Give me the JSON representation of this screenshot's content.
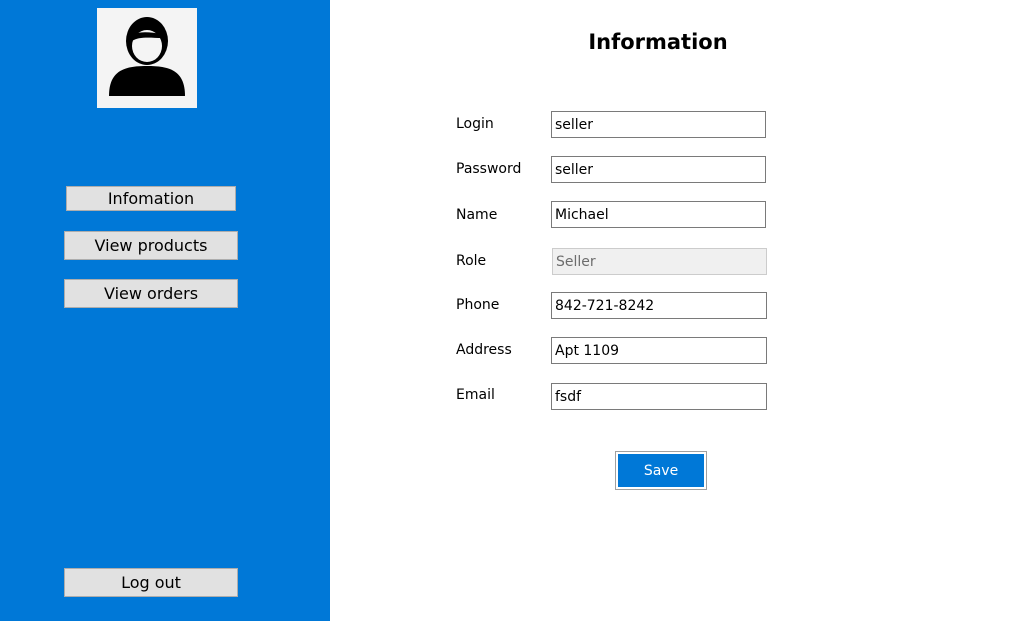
{
  "colors": {
    "sidebar_bg": "#0078d7",
    "save_button_bg": "#0078d7"
  },
  "sidebar": {
    "avatar_icon": "user-avatar-icon",
    "nav": [
      {
        "label": "Infomation"
      },
      {
        "label": "View products"
      },
      {
        "label": "View orders"
      }
    ],
    "logout_label": "Log out"
  },
  "form": {
    "title": "Information",
    "fields": [
      {
        "label": "Login",
        "value": "seller",
        "disabled": false
      },
      {
        "label": "Password",
        "value": "seller",
        "disabled": false
      },
      {
        "label": "Name",
        "value": "Michael",
        "disabled": false
      },
      {
        "label": "Role",
        "value": "Seller",
        "disabled": true
      },
      {
        "label": "Phone",
        "value": "842-721-8242",
        "disabled": false
      },
      {
        "label": "Address",
        "value": "Apt 1109",
        "disabled": false
      },
      {
        "label": "Email",
        "value": "fsdf",
        "disabled": false
      }
    ],
    "save_label": "Save"
  }
}
